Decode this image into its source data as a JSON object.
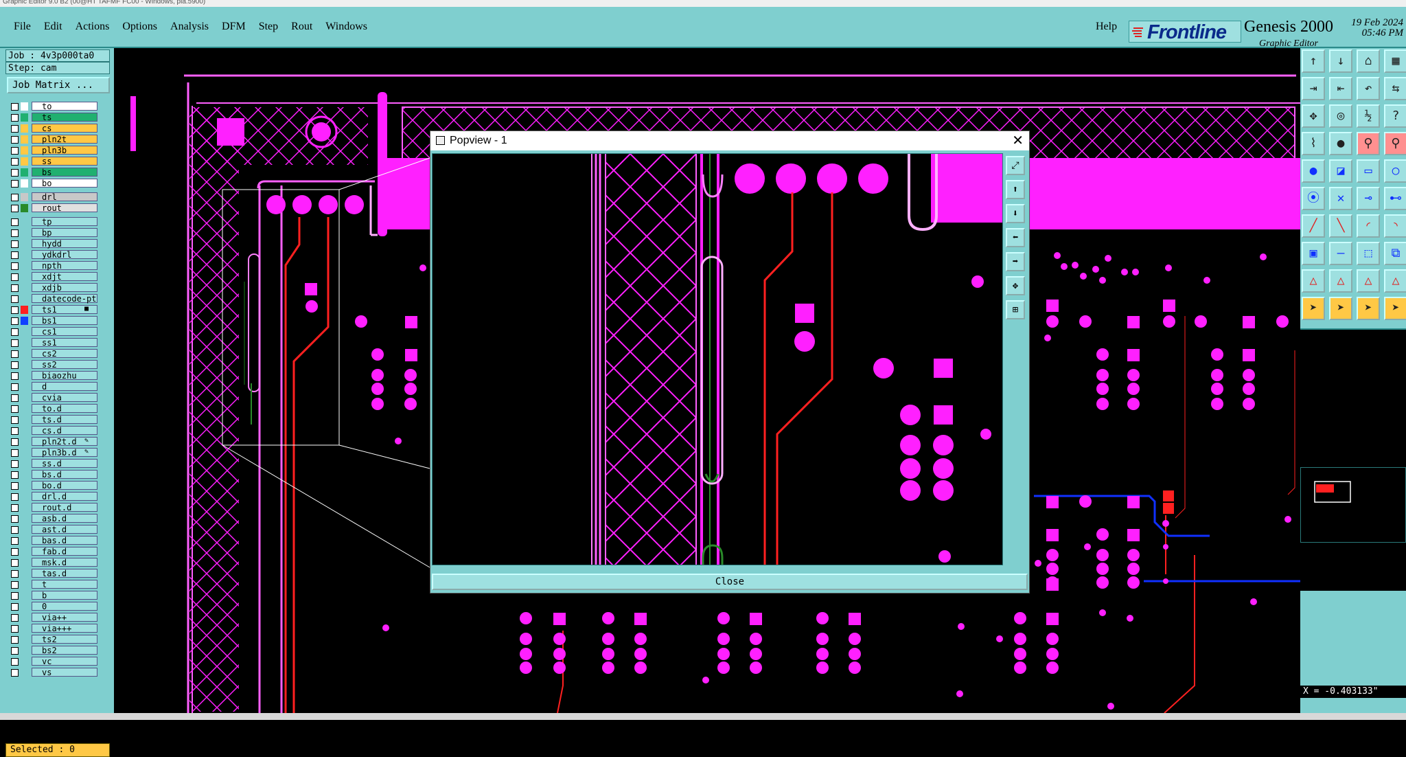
{
  "window": {
    "title": "Graphic Editor 9.0 B2 (00@HT TAFMF FC00 - Windows, pla.5900)"
  },
  "menu": {
    "items": [
      "File",
      "Edit",
      "Actions",
      "Options",
      "Analysis",
      "DFM",
      "Step",
      "Rout",
      "Windows"
    ],
    "help": "Help"
  },
  "brand": {
    "logo": "Frontline",
    "product": "Genesis 2000",
    "subtitle": "Graphic Editor",
    "date": "19 Feb 2024",
    "time": "05:46 PM"
  },
  "job": {
    "label": "Job : 4v3p000ta0",
    "step": "Step: cam",
    "matrix_button": "Job Matrix ..."
  },
  "layers": [
    {
      "name": "to",
      "color": "#ffffff",
      "bg": "#ffffff"
    },
    {
      "name": "ts",
      "color": "#20b070",
      "bg": "#20b070"
    },
    {
      "name": "cs",
      "color": "#ffc845",
      "bg": "#ffc845"
    },
    {
      "name": "pln2t",
      "color": "#ffc845",
      "bg": "#ffc845"
    },
    {
      "name": "pln3b",
      "color": "#ffc845",
      "bg": "#ffc845"
    },
    {
      "name": "ss",
      "color": "#ffc845",
      "bg": "#ffc845"
    },
    {
      "name": "bs",
      "color": "#20b070",
      "bg": "#20b070"
    },
    {
      "name": "bo",
      "color": "#ffffff",
      "bg": "#ffffff"
    },
    {
      "name": "drl",
      "color": "#c8c8c8",
      "bg": "#c8c8c8"
    },
    {
      "name": "rout",
      "color": "#2a8a2a",
      "bg": "#e0e0e0"
    },
    {
      "name": "tp",
      "color": "",
      "bg": ""
    },
    {
      "name": "bp",
      "color": "",
      "bg": ""
    },
    {
      "name": "hydd",
      "color": "",
      "bg": ""
    },
    {
      "name": "ydkdrl",
      "color": "",
      "bg": ""
    },
    {
      "name": "npth",
      "color": "",
      "bg": ""
    },
    {
      "name": "xdjt",
      "color": "",
      "bg": ""
    },
    {
      "name": "xdjb",
      "color": "",
      "bg": ""
    },
    {
      "name": "datecode-pt",
      "color": "",
      "bg": ""
    },
    {
      "name": "ts1",
      "color": "#ff2020",
      "bg": "",
      "mark": "■"
    },
    {
      "name": "bs1",
      "color": "#1040ff",
      "bg": ""
    },
    {
      "name": "cs1",
      "color": "",
      "bg": ""
    },
    {
      "name": "ss1",
      "color": "",
      "bg": ""
    },
    {
      "name": "cs2",
      "color": "",
      "bg": ""
    },
    {
      "name": "ss2",
      "color": "",
      "bg": ""
    },
    {
      "name": "biaozhu",
      "color": "",
      "bg": ""
    },
    {
      "name": "d",
      "color": "",
      "bg": ""
    },
    {
      "name": "cvia",
      "color": "",
      "bg": ""
    },
    {
      "name": "to.d",
      "color": "",
      "bg": ""
    },
    {
      "name": "ts.d",
      "color": "",
      "bg": ""
    },
    {
      "name": "cs.d",
      "color": "",
      "bg": ""
    },
    {
      "name": "pln2t.d",
      "color": "",
      "bg": "",
      "mark": "✎"
    },
    {
      "name": "pln3b.d",
      "color": "",
      "bg": "",
      "mark": "✎"
    },
    {
      "name": "ss.d",
      "color": "",
      "bg": ""
    },
    {
      "name": "bs.d",
      "color": "",
      "bg": ""
    },
    {
      "name": "bo.d",
      "color": "",
      "bg": ""
    },
    {
      "name": "drl.d",
      "color": "",
      "bg": ""
    },
    {
      "name": "rout.d",
      "color": "",
      "bg": ""
    },
    {
      "name": "asb.d",
      "color": "",
      "bg": ""
    },
    {
      "name": "ast.d",
      "color": "",
      "bg": ""
    },
    {
      "name": "bas.d",
      "color": "",
      "bg": ""
    },
    {
      "name": "fab.d",
      "color": "",
      "bg": ""
    },
    {
      "name": "msk.d",
      "color": "",
      "bg": ""
    },
    {
      "name": "tas.d",
      "color": "",
      "bg": ""
    },
    {
      "name": "t",
      "color": "",
      "bg": ""
    },
    {
      "name": "b",
      "color": "",
      "bg": ""
    },
    {
      "name": "0",
      "color": "",
      "bg": ""
    },
    {
      "name": "via++",
      "color": "",
      "bg": ""
    },
    {
      "name": "via+++",
      "color": "",
      "bg": ""
    },
    {
      "name": "ts2",
      "color": "",
      "bg": ""
    },
    {
      "name": "bs2",
      "color": "",
      "bg": ""
    },
    {
      "name": "vc",
      "color": "",
      "bg": ""
    },
    {
      "name": "vs",
      "color": "",
      "bg": ""
    }
  ],
  "status": {
    "selected": "Selected : 0",
    "coord_x": "X = -0.403133\""
  },
  "popview": {
    "title": "Popview - 1",
    "close_label": "Close"
  },
  "colors": {
    "panel": "#7fcfcf",
    "pad": "#ff20ff",
    "trace": "#ff2020",
    "net": "#1030ff",
    "accent": "#ffc845"
  },
  "tools": [
    "layer-up-icon",
    "layer-down-icon",
    "home-icon",
    "grid-icon",
    "in-icon",
    "out-icon",
    "undo-icon",
    "split-icon",
    "fit-icon",
    "center-icon",
    "scale-1-2-icon",
    "query-icon",
    "snap-icon",
    "cursor-icon",
    "filter-icon",
    "filter-red-icon",
    "pad-icon",
    "pattern-icon",
    "ruler-icon",
    "circle-icon",
    "connect-icon",
    "cross-icon",
    "node-icon",
    "link-icon",
    "line-icon",
    "line2-icon",
    "arc-icon",
    "arc2-icon",
    "layer-add-icon",
    "minus-icon",
    "frame-icon",
    "copy-icon",
    "tri-icon",
    "tri2-icon",
    "tri3-icon",
    "tri4-icon",
    "pointer-icon",
    "select-icon",
    "select2-icon",
    "select3-icon"
  ],
  "popview_tools": [
    "pv-fit-icon",
    "pv-up-icon",
    "pv-down-icon",
    "pv-left-icon",
    "pv-right-icon",
    "pv-zoom-icon",
    "pv-grid-icon"
  ]
}
